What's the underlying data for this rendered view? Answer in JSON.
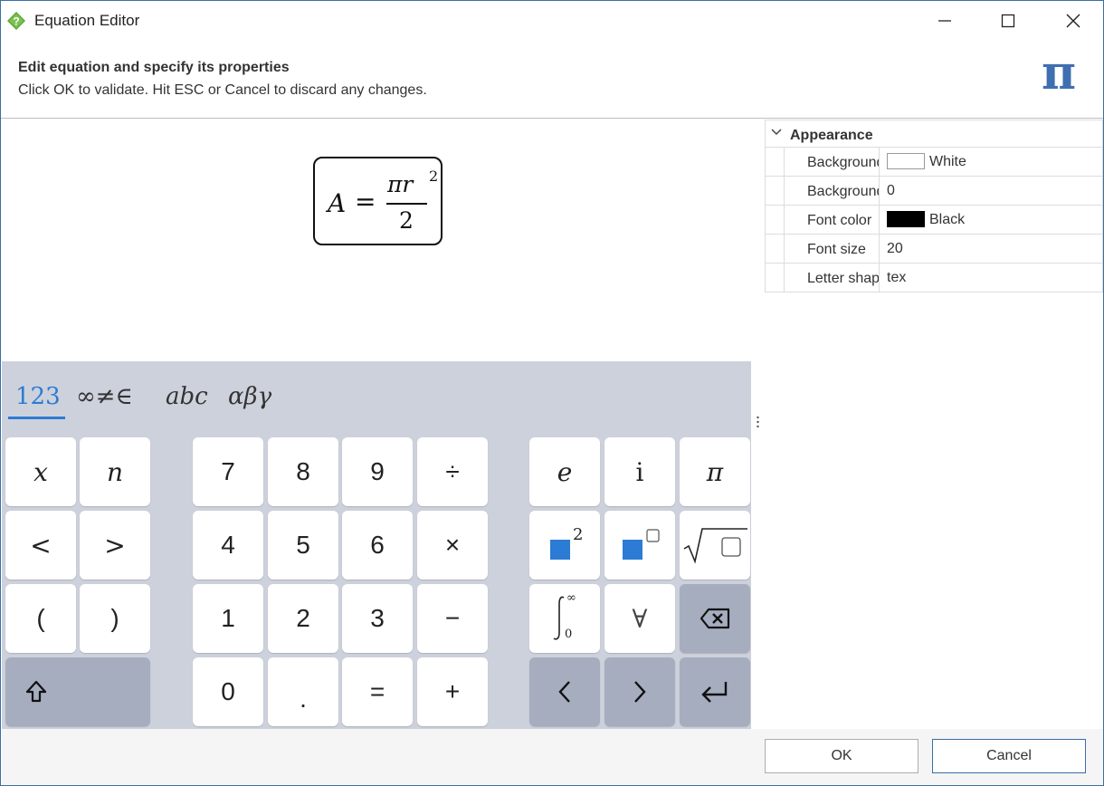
{
  "window": {
    "title": "Equation Editor",
    "controls": [
      "minimize",
      "maximize",
      "close"
    ]
  },
  "header": {
    "title": "Edit equation and specify its properties",
    "subtitle": "Click OK to validate. Hit ESC or Cancel to discard any changes.",
    "logo_glyph": "π"
  },
  "equation": {
    "lhs": "A",
    "op": "=",
    "numerator": "πr",
    "exponent": "2",
    "denominator": "2"
  },
  "keyboard": {
    "tabs": [
      {
        "id": "123",
        "label": "123",
        "active": true
      },
      {
        "id": "sym",
        "label": "∞≠∈",
        "active": false
      },
      {
        "id": "abc",
        "label": "abc",
        "active": false
      },
      {
        "id": "greek",
        "label": "αβγ",
        "active": false
      }
    ],
    "keys": {
      "x": "x",
      "n": "n",
      "lt": "<",
      "gt": ">",
      "lparen": "(",
      "rparen": ")",
      "d7": "7",
      "d8": "8",
      "d9": "9",
      "div": "÷",
      "d4": "4",
      "d5": "5",
      "d6": "6",
      "mul": "×",
      "d1": "1",
      "d2": "2",
      "d3": "3",
      "minus": "−",
      "d0": "0",
      "dot": ".",
      "equals": "=",
      "plus": "+",
      "e": "e",
      "i": "i",
      "pi": "π",
      "square_exp": "2",
      "int_upper": "∞",
      "int_lower": "0",
      "forall": "∀"
    },
    "accent_color": "#2c7bd4",
    "dark_key_color": "#a6adbf"
  },
  "properties": {
    "group": "Appearance",
    "rows": [
      {
        "name": "Background",
        "value": "White",
        "swatch": "#ffffff"
      },
      {
        "name": "Background",
        "value": "0"
      },
      {
        "name": "Font color",
        "value": "Black",
        "swatch": "#000000"
      },
      {
        "name": "Font size",
        "value": "20"
      },
      {
        "name": "Letter shap",
        "value": "tex"
      }
    ]
  },
  "footer": {
    "ok_label": "OK",
    "cancel_label": "Cancel"
  }
}
